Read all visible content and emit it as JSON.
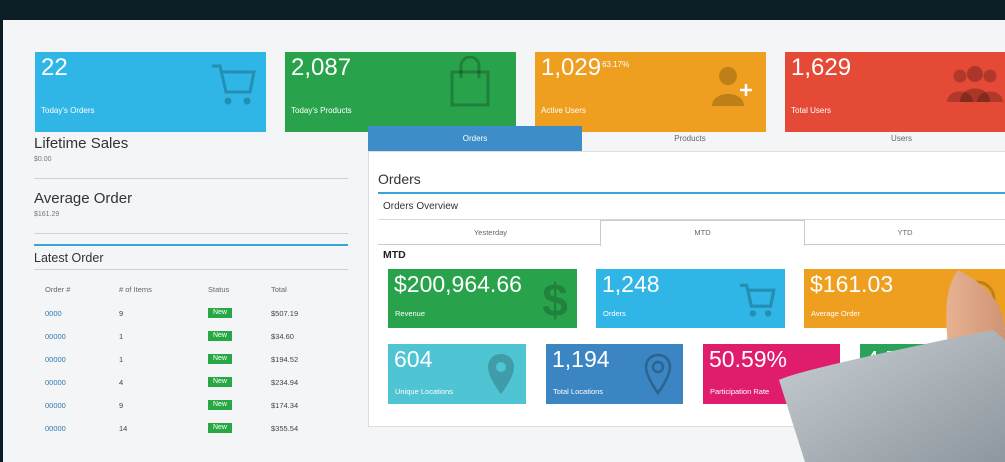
{
  "stats": [
    {
      "value": "22",
      "label": "Today's Orders",
      "color": "#2fb6e6",
      "icon": "cart-icon"
    },
    {
      "value": "2,087",
      "label": "Today's Products",
      "color": "#29a34b",
      "icon": "shopping-bag-icon"
    },
    {
      "value": "1,029",
      "sup": "63.17%",
      "label": "Active Users",
      "color": "#ef9f1f",
      "icon": "add-user-icon"
    },
    {
      "value": "1,629",
      "label": "Total Users",
      "color": "#e44a36",
      "icon": "users-group-icon"
    }
  ],
  "lifetime": {
    "title": "Lifetime Sales",
    "value": "$0.00"
  },
  "average": {
    "title": "Average Order",
    "value": "$161.29"
  },
  "latest": {
    "title": "Latest Order",
    "headers": [
      "Order #",
      "# of Items",
      "Status",
      "Total"
    ],
    "rows": [
      {
        "order": "0000",
        "items": "9",
        "status": "New",
        "total": "$507.19"
      },
      {
        "order": "00000",
        "items": "1",
        "status": "New",
        "total": "$34.60"
      },
      {
        "order": "00000",
        "items": "1",
        "status": "New",
        "total": "$194.52"
      },
      {
        "order": "00000",
        "items": "4",
        "status": "New",
        "total": "$234.94"
      },
      {
        "order": "00000",
        "items": "9",
        "status": "New",
        "total": "$174.34"
      },
      {
        "order": "00000",
        "items": "14",
        "status": "New",
        "total": "$355.54"
      }
    ]
  },
  "tabs": [
    "Orders",
    "Products",
    "Users"
  ],
  "panel": {
    "title": "Orders",
    "subtitle": "Orders Overview",
    "period_tabs": [
      "Yesterday",
      "MTD",
      "YTD"
    ],
    "section": "MTD"
  },
  "tiles": [
    {
      "value": "$200,964.66",
      "label": "Revenue",
      "color": "#29a34b",
      "icon": "dollar-icon"
    },
    {
      "value": "1,248",
      "label": "Orders",
      "color": "#2fb6e6",
      "icon": "cart-icon"
    },
    {
      "value": "$161.03",
      "label": "Average Order",
      "color": "#ef9f1f",
      "icon": "dollar-circle-icon"
    },
    {
      "value": "604",
      "label": "Unique Locations",
      "color": "#4fc4d2",
      "icon": "map-pin-icon"
    },
    {
      "value": "1,194",
      "label": "Total Locations",
      "color": "#3a85c2",
      "icon": "map-pin-outline-icon"
    },
    {
      "value": "50.59%",
      "label": "Participation Rate",
      "color": "#e01c6c",
      "icon": "percent-icon"
    },
    {
      "value": "4.5",
      "label": "",
      "color": "#2aa25a",
      "icon": "star-icon"
    }
  ]
}
